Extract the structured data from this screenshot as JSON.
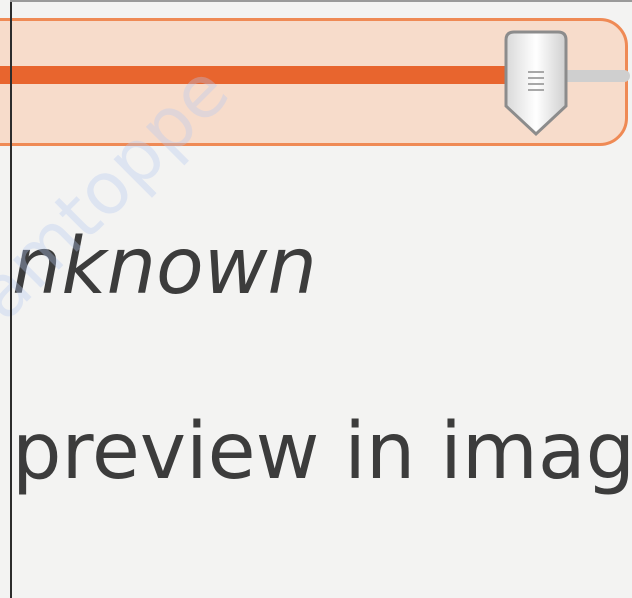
{
  "slider": {
    "value_percent": 84,
    "fill_color": "#e8652e",
    "trough_color": "#f7dccb",
    "border_color": "#ef8a55"
  },
  "rows": {
    "unknown_label": "nknown",
    "preview_label": "preview in image v",
    "partial_label": ""
  },
  "watermark": {
    "text": "amtoppe"
  }
}
